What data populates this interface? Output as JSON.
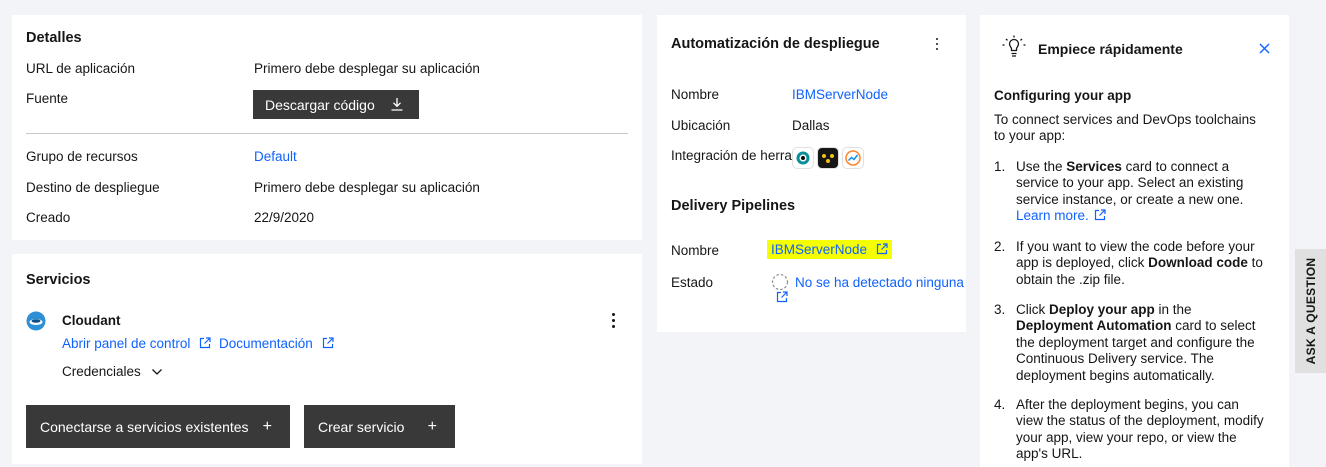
{
  "details": {
    "title": "Detalles",
    "url_label": "URL de aplicación",
    "url_value": "Primero debe desplegar su aplicación",
    "source_label": "Fuente",
    "download_button": "Descargar código",
    "resource_group_label": "Grupo de recursos",
    "resource_group_value": "Default",
    "deploy_target_label": "Destino de despliegue",
    "deploy_target_value": "Primero debe desplegar su aplicación",
    "created_label": "Creado",
    "created_value": "22/9/2020"
  },
  "services": {
    "title": "Servicios",
    "service_name": "Cloudant",
    "dashboard_link": "Abrir panel de control",
    "docs_link": "Documentación",
    "credentials": "Credenciales",
    "connect_button": "Conectarse a servicios existentes",
    "create_button": "Crear servicio"
  },
  "automation": {
    "title": "Automatización de despliegue",
    "name_label": "Nombre",
    "name_value": "IBMServerNode",
    "location_label": "Ubicación",
    "location_value": "Dallas",
    "integration_label": "Integración de herramientas",
    "pipelines_title": "Delivery Pipelines",
    "pipeline_name_label": "Nombre",
    "pipeline_name_value": "IBMServerNode",
    "status_label": "Estado",
    "status_value": "No se ha detectado ninguna fase"
  },
  "quickstart": {
    "title": "Empiece rápidamente",
    "heading": "Configuring your app",
    "intro": "To connect services and DevOps toolchains to your app:",
    "steps": [
      {
        "num": "1.",
        "pre": "Use the ",
        "bold": "Services",
        "post": " card to connect a service to your app. Select an existing service instance, or create a new one. ",
        "link": "Learn more."
      },
      {
        "num": "2.",
        "pre": "If you want to view the code before your app is deployed, click ",
        "bold": "Download code",
        "post": " to obtain the .zip file."
      },
      {
        "num": "3.",
        "pre": "Click ",
        "bold": "Deploy your app",
        "mid": " in the ",
        "bold2": "Deployment Automation",
        "post": " card to select the deployment target and configure the Continuous Delivery service. The deployment begins automatically."
      },
      {
        "num": "4.",
        "pre": "After the deployment begins, you can view the status of the deployment, modify your app, view your repo, or view the app's URL."
      }
    ]
  },
  "ask_tab": "ASK A QUESTION",
  "colors": {
    "link": "#0f62fe",
    "button": "#393939",
    "highlight": "#f6ff00",
    "page": "#f2f4f8"
  }
}
